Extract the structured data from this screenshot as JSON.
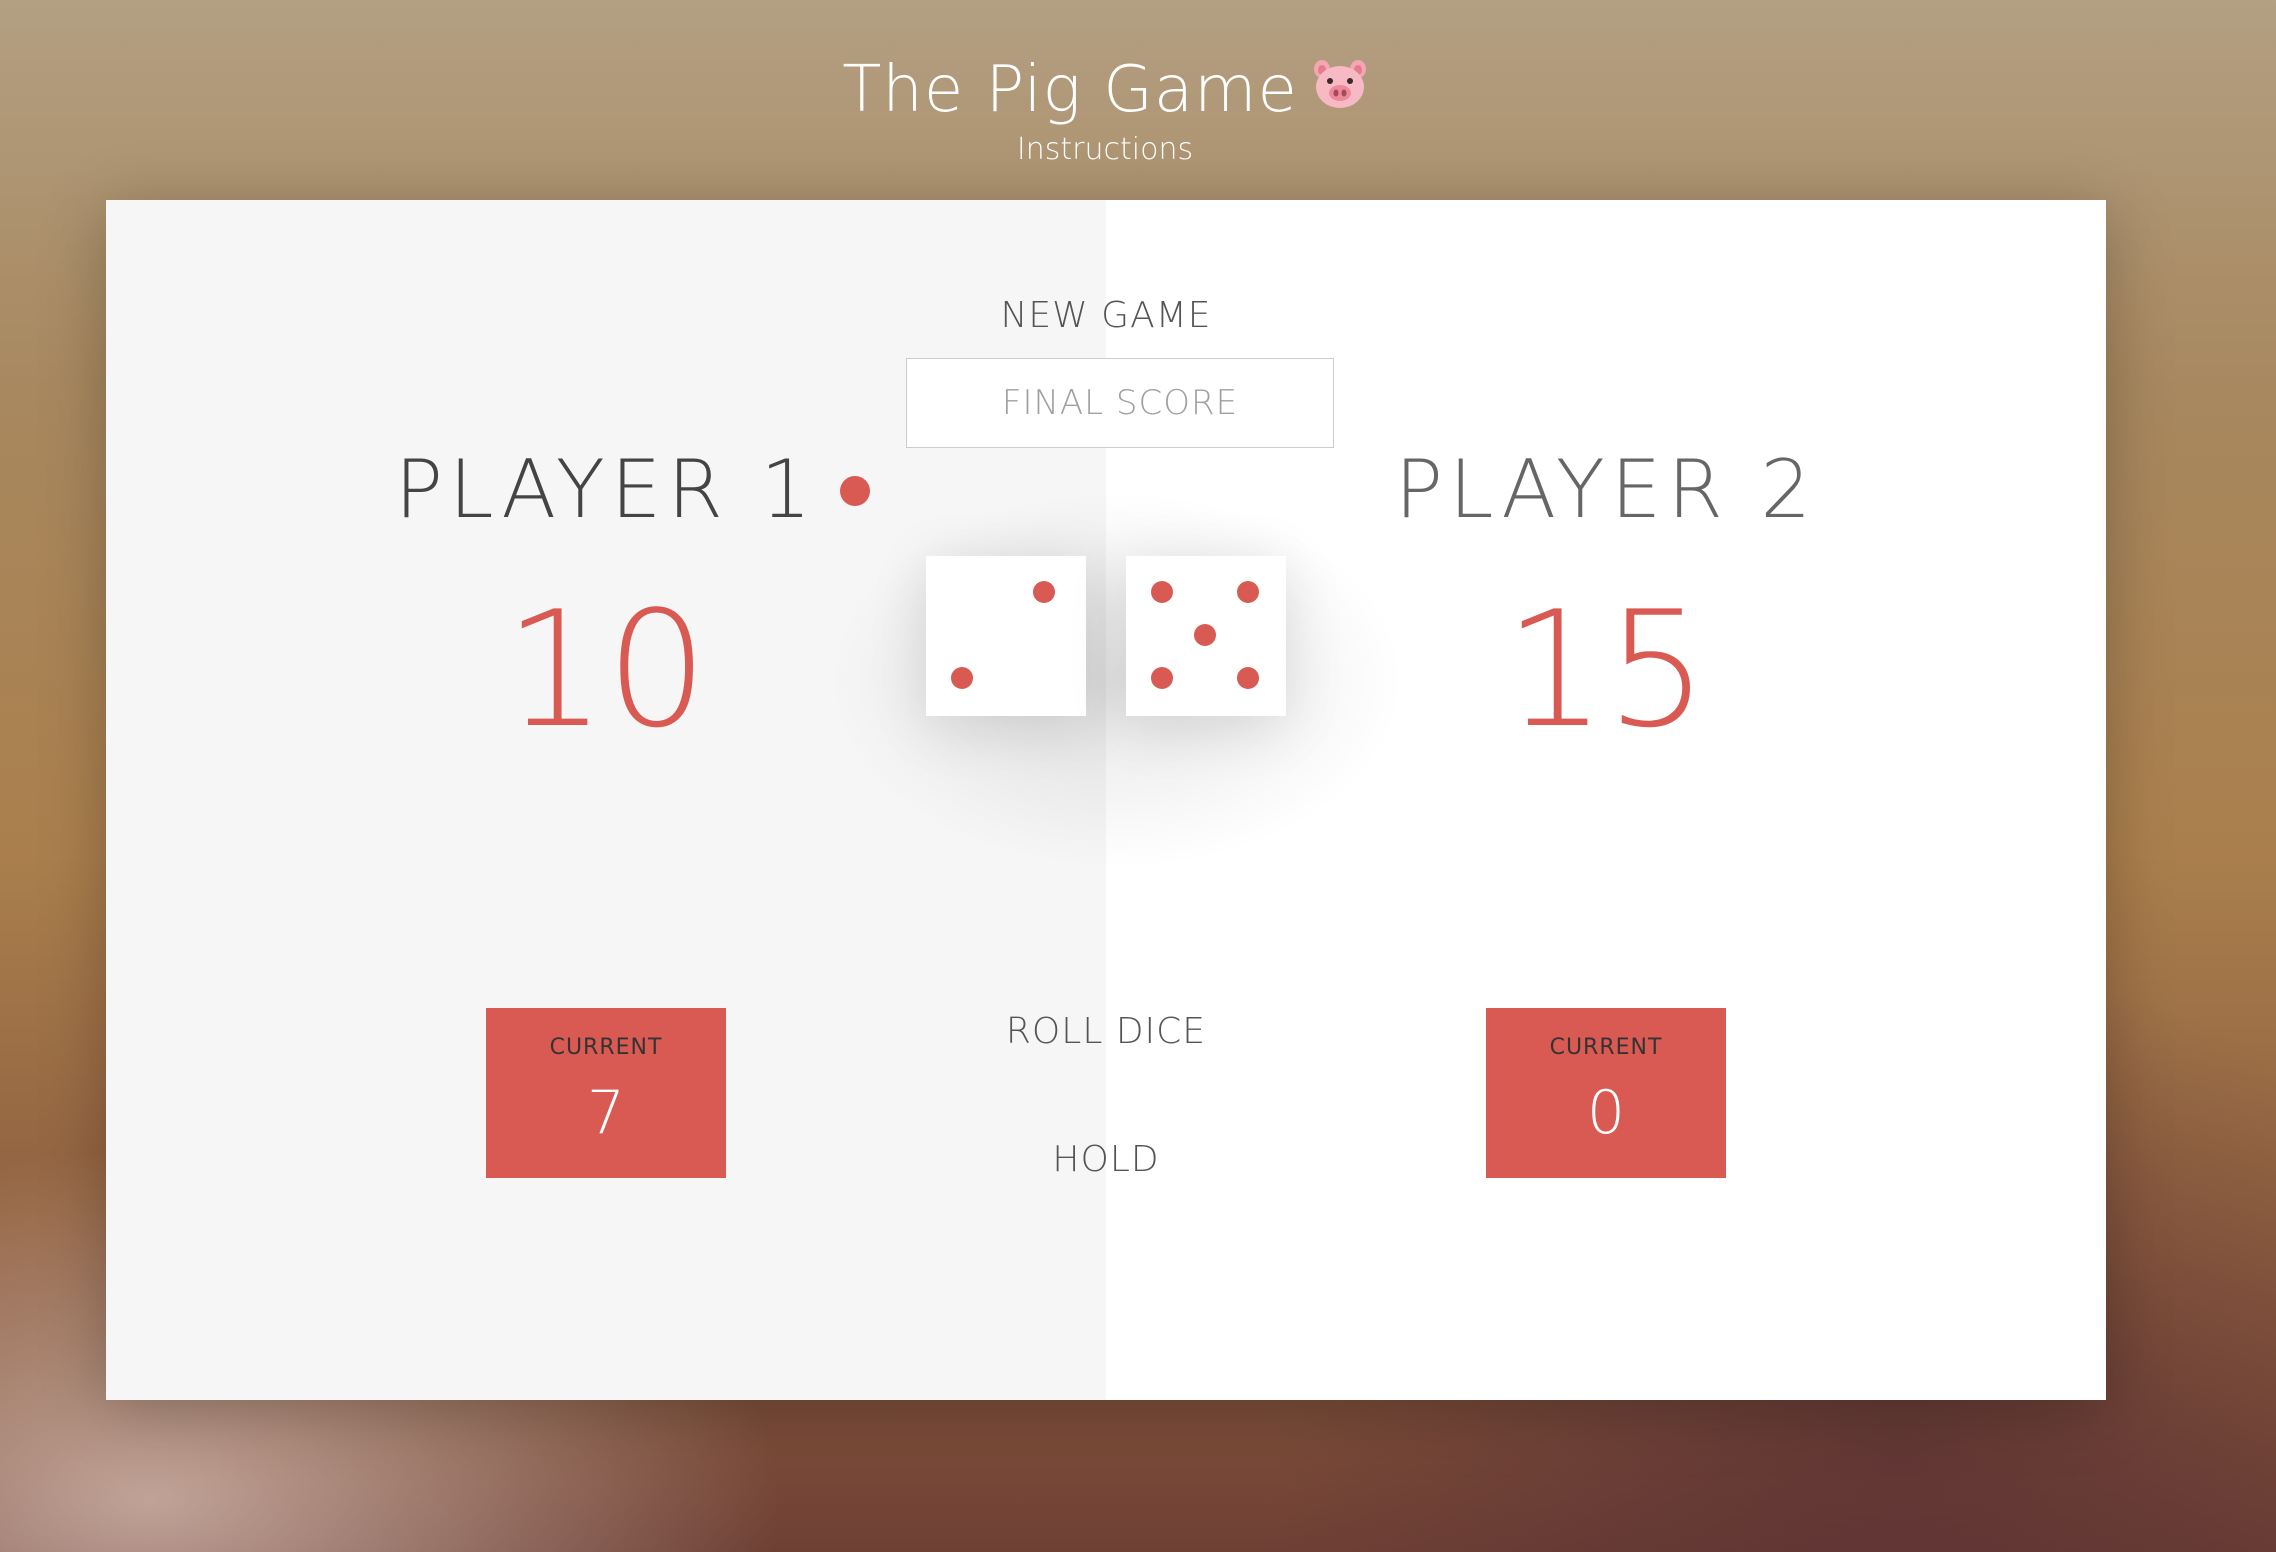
{
  "header": {
    "title": "The Pig Game",
    "subtitle": "Instructions",
    "title_icon": "pig-face-icon"
  },
  "controls": {
    "new_game": "NEW GAME",
    "final_score_placeholder": "FINAL SCORE",
    "final_score_value": "",
    "roll_dice": "ROLL DICE",
    "hold": "HOLD"
  },
  "players": [
    {
      "name": "PLAYER 1",
      "score": "10",
      "current_label": "CURRENT",
      "current": "7",
      "active": true
    },
    {
      "name": "PLAYER 2",
      "score": "15",
      "current_label": "CURRENT",
      "current": "0",
      "active": false
    }
  ],
  "dice": [
    2,
    5
  ],
  "colors": {
    "accent": "#d95a53",
    "panel_active": "#f6f6f6",
    "panel_inactive": "#ffffff"
  }
}
